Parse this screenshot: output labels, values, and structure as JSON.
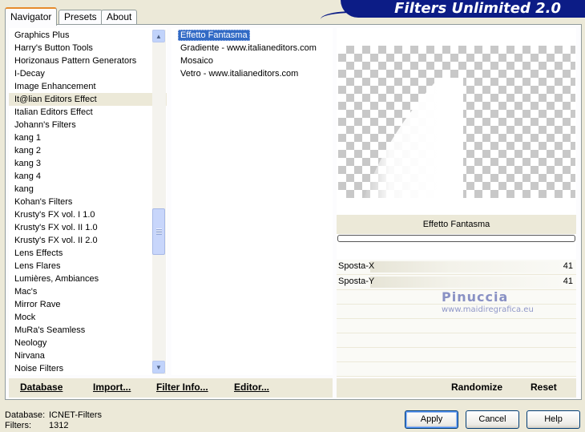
{
  "window": {
    "title": "Filters Unlimited 2.0"
  },
  "tabs": [
    {
      "label": "Navigator",
      "active": true
    },
    {
      "label": "Presets",
      "active": false
    },
    {
      "label": "About",
      "active": false
    }
  ],
  "filter_categories": [
    "Graphics Plus",
    "Harry's Button Tools",
    "Horizonaus Pattern Generators",
    "I-Decay",
    "Image Enhancement",
    "It@lian Editors Effect",
    "Italian Editors Effect",
    "Johann's Filters",
    "kang 1",
    "kang 2",
    "kang 3",
    "kang 4",
    "kang",
    "Kohan's Filters",
    "Krusty's FX vol. I 1.0",
    "Krusty's FX vol. II 1.0",
    "Krusty's FX vol. II 2.0",
    "Lens Effects",
    "Lens Flares",
    "Lumières, Ambiances",
    "Mac's",
    "Mirror Rave",
    "Mock",
    "MuRa's Seamless",
    "Neology",
    "Nirvana",
    "Noise Filters"
  ],
  "selected_category": "It@lian Editors Effect",
  "effects": [
    "Effetto Fantasma",
    "Gradiente - www.italianeditors.com",
    "Mosaico",
    "Vetro - www.italianeditors.com"
  ],
  "selected_effect": "Effetto Fantasma",
  "effect_title": "Effetto Fantasma",
  "params": [
    {
      "name": "Sposta-X",
      "value": "41"
    },
    {
      "name": "Sposta-Y",
      "value": "41"
    }
  ],
  "watermark": {
    "line1": "Pinuccia",
    "line2": "www.maidiregrafica.eu"
  },
  "toolbar": {
    "database": "Database",
    "import": "Import...",
    "filter_info": "Filter Info...",
    "editor": "Editor...",
    "randomize": "Randomize",
    "reset": "Reset"
  },
  "status": {
    "database_label": "Database:",
    "database_value": "ICNET-Filters",
    "filters_label": "Filters:",
    "filters_value": "1312"
  },
  "buttons": {
    "apply": "Apply",
    "cancel": "Cancel",
    "help": "Help"
  },
  "colors": {
    "title_bar": "#0c1c86",
    "selection": "#316ac5",
    "panel_bg": "#ece9d8"
  }
}
